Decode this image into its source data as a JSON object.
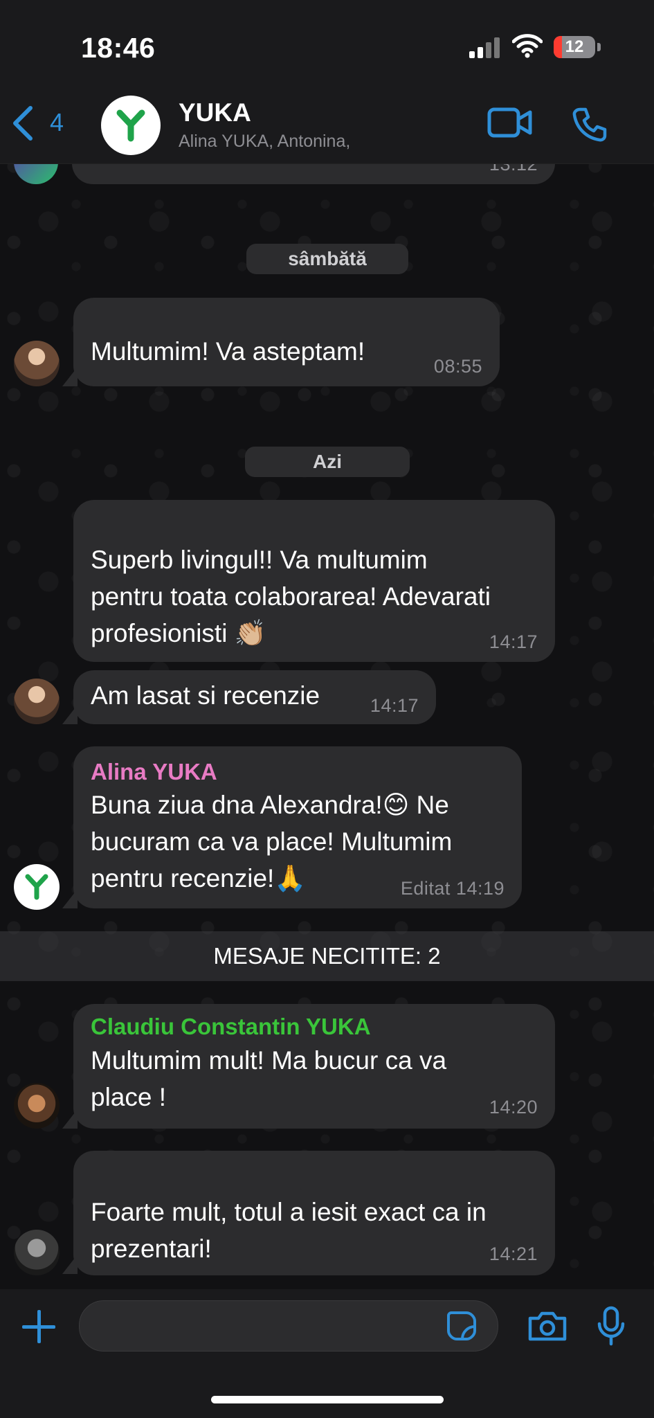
{
  "status_bar": {
    "time": "18:46",
    "battery": "12"
  },
  "header": {
    "back_count": "4",
    "title": "YUKA",
    "subtitle": "Alina  YUKA, Antonina,",
    "top_partial_time": "13:12",
    "accent_color": "#2f8fd8",
    "icons": [
      "chevron-left-icon",
      "video-call-icon",
      "phone-icon"
    ]
  },
  "messages": [
    {
      "type": "date",
      "label": "sâmbătă"
    },
    {
      "type": "msg",
      "text": "Multumim! Va asteptam!",
      "time": "08:55"
    },
    {
      "type": "date",
      "label": "Azi"
    },
    {
      "type": "msg",
      "text": "Superb livingul!! Va multumim\npentru toata colaborarea! Adevarati\nprofesionisti 👏🏼",
      "time": "14:17"
    },
    {
      "type": "msg",
      "text": "Am lasat si recenzie",
      "time": "14:17"
    },
    {
      "type": "msg",
      "sender": "Alina  YUKA",
      "sender_color": "#e87bc4",
      "text": "Buna ziua dna Alexandra!😊 Ne\nbucuram ca va place! Multumim\npentru recenzie!🙏",
      "time": "14:19",
      "edited": "Editat"
    },
    {
      "type": "unread",
      "label": "MESAJE NECITITE: 2"
    },
    {
      "type": "msg",
      "sender": "Claudiu Constantin YUKA",
      "sender_color": "#3ac53a",
      "text": "Multumim mult! Ma bucur ca va\nplace !",
      "time": "14:20"
    },
    {
      "type": "msg",
      "text": "Foarte mult, totul a iesit exact ca in\nprezentari!",
      "time": "14:21"
    }
  ],
  "input_bar": {
    "icons": [
      "plus-icon",
      "sticker-icon",
      "camera-icon",
      "microphone-icon"
    ]
  }
}
